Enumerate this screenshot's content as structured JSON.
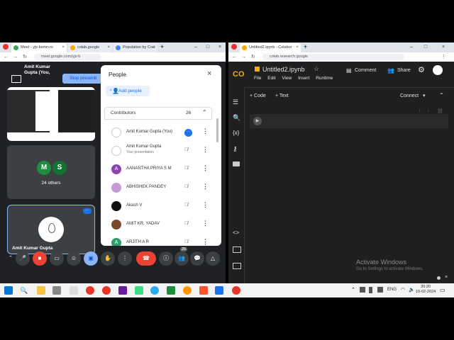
{
  "meet_window": {
    "tabs": [
      {
        "label": "Meet - yjx-bsmn-ro",
        "active": true
      },
      {
        "label": "colab.google",
        "active": false
      },
      {
        "label": "Population by Cou",
        "active": false
      }
    ],
    "url": "meet.google.com/yjx-b",
    "presenter_label": "Amit Kumar Gupta (You,",
    "stop_presenting": "Stop presenti",
    "others_initials": [
      "M",
      "S"
    ],
    "others_label": "24 others",
    "self_tile_name": "Amit Kumar Gupta",
    "participant_count": "26",
    "people_panel": {
      "title": "People",
      "add_people": "Add people",
      "section": "Contributors",
      "section_count": "26",
      "participants": [
        {
          "name": "Amit Kumar Gupta (You)",
          "sub": "",
          "initial": "",
          "color": "#ffffff"
        },
        {
          "name": "Amit Kumar Gupta",
          "sub": "Your presentation",
          "initial": "",
          "color": "#ffffff"
        },
        {
          "name": "AANANTHA PRIYA S M",
          "sub": "",
          "initial": "A",
          "color": "#8e44ad"
        },
        {
          "name": "ABHISHEK PANDEY",
          "sub": "",
          "initial": "",
          "color": "#c79bd6"
        },
        {
          "name": "Akash V",
          "sub": "",
          "initial": "",
          "color": "#111111"
        },
        {
          "name": "AMIT KR. YADAV",
          "sub": "",
          "initial": "",
          "color": "#7a4a2a"
        },
        {
          "name": "ARJITH A R",
          "sub": "",
          "initial": "A",
          "color": "#2e9e6a"
        }
      ]
    }
  },
  "colab_window": {
    "tabs": [
      {
        "label": "Untitled2.ipynb - Colabor",
        "active": true
      }
    ],
    "url": "colab.research.google",
    "logo": "CO",
    "filename": "Untitled2.ipynb",
    "menu": [
      "File",
      "Edit",
      "View",
      "Insert",
      "Runtime"
    ],
    "comment": "Comment",
    "share": "Share",
    "add_code": "+ Code",
    "add_text": "+ Text",
    "connect": "Connect",
    "activate_title": "Activate Windows",
    "activate_sub": "Go to Settings to activate Windows."
  },
  "taskbar": {
    "lang": "ENG",
    "time": "20:20",
    "date": "10-02-2024"
  }
}
